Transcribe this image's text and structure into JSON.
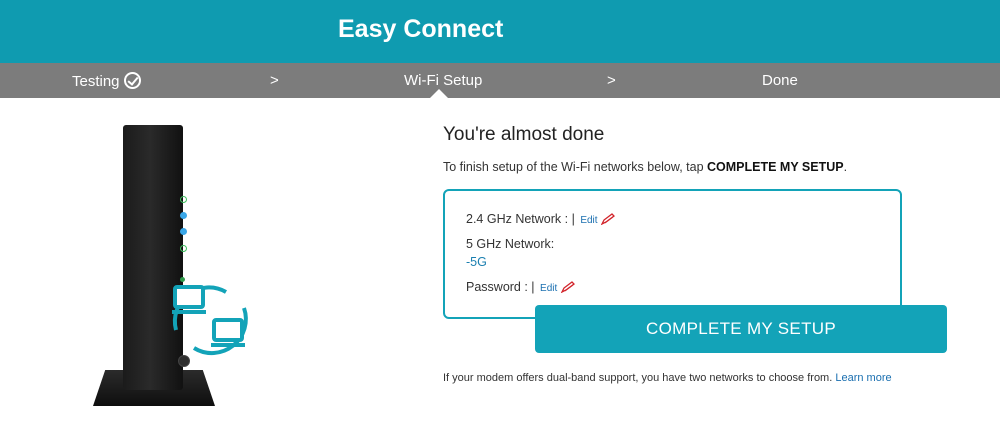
{
  "header": {
    "title": "Easy Connect"
  },
  "steps": {
    "testing": "Testing",
    "separator1": ">",
    "wifi_setup": "Wi-Fi Setup",
    "separator2": ">",
    "done": "Done"
  },
  "main": {
    "headline": "You're almost done",
    "instruction_prefix": "To finish setup of the Wi-Fi networks below, tap ",
    "instruction_emphasis": "COMPLETE MY SETUP",
    "instruction_suffix": "."
  },
  "networks": {
    "network_24_label": "2.4 GHz Network : |",
    "network_24_edit": "Edit",
    "network_5_label": "5 GHz Network:",
    "network_5_ssid": "-5G",
    "password_label": "Password : |",
    "password_edit": "Edit"
  },
  "actions": {
    "complete_label": "COMPLETE MY SETUP"
  },
  "footer": {
    "note": "If your modem offers dual-band support, you have two networks to choose from. ",
    "learn_more": "Learn more"
  },
  "icons": {
    "check": "check-circle-icon",
    "pencil": "pencil-icon",
    "devices": "devices-icon"
  },
  "colors": {
    "brand": "#0f9bb0",
    "step_bar": "#7c7c7c",
    "accent": "#13a3b8",
    "link": "#1a6fb0",
    "pencil": "#d2232a"
  }
}
